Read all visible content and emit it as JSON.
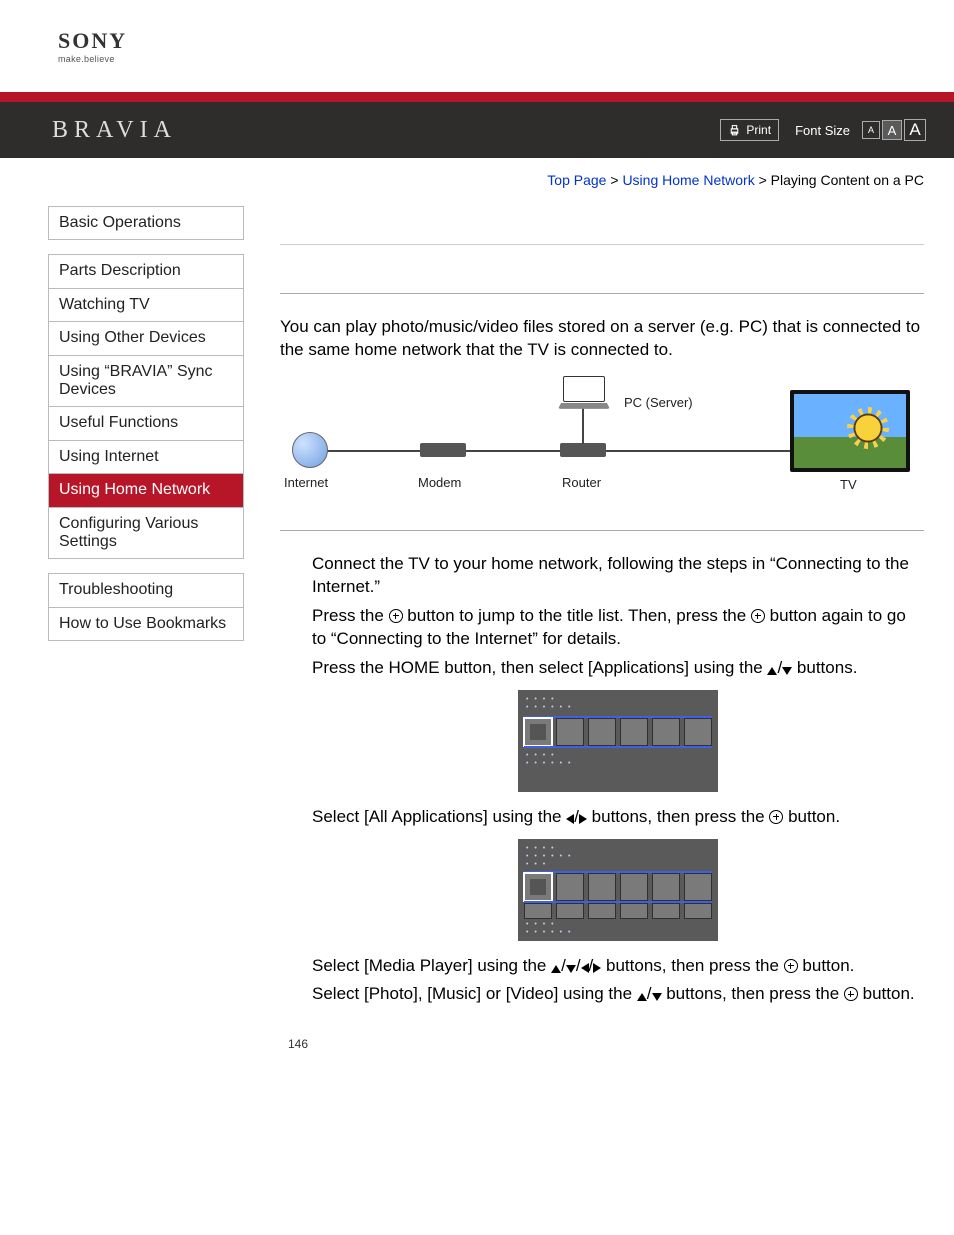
{
  "brand": {
    "name": "SONY",
    "tagline": "make.believe",
    "product": "BRAVIA"
  },
  "header": {
    "print": "Print",
    "fontsize_label": "Font Size",
    "fs_s": "A",
    "fs_m": "A",
    "fs_l": "A"
  },
  "breadcrumb": {
    "top": "Top Page",
    "sec": "Using Home Network",
    "cur": "Playing Content on a PC",
    "sep": ">"
  },
  "nav": {
    "g1": [
      "Basic Operations"
    ],
    "g2": [
      "Parts Description",
      "Watching TV",
      "Using Other Devices",
      "Using “BRAVIA” Sync Devices",
      "Useful Functions",
      "Using Internet",
      "Using Home Network",
      "Configuring Various Settings"
    ],
    "g3": [
      "Troubleshooting",
      "How to Use Bookmarks"
    ],
    "active": "Using Home Network"
  },
  "content": {
    "intro": "You can play photo/music/video files stored on a server (e.g. PC) that is connected to the same home network that the TV is connected to.",
    "dia": {
      "internet": "Internet",
      "modem": "Modem",
      "router": "Router",
      "pc": "PC (Server)",
      "tv": "TV"
    },
    "step1a": "Connect the TV to your home network, following the steps in “Connecting to the Internet.”",
    "step1b_1": "Press the ",
    "step1b_2": " button to jump to the title list. Then, press the ",
    "step1b_3": " button again to go to “Connecting to the Internet” for details.",
    "step2_1": "Press the HOME button, then select [Applications] using the ",
    "step2_2": " buttons.",
    "step3_1": "Select [All Applications] using the ",
    "step3_2": " buttons, then press the ",
    "step3_3": " button.",
    "step4_1": "Select [Media Player] using the ",
    "step4_2": " buttons, then press the ",
    "step4_3": " button.",
    "step5_1": "Select [Photo], [Music] or [Video] using the ",
    "step5_2": " buttons, then press the ",
    "step5_3": " button."
  },
  "pagenum": "146"
}
